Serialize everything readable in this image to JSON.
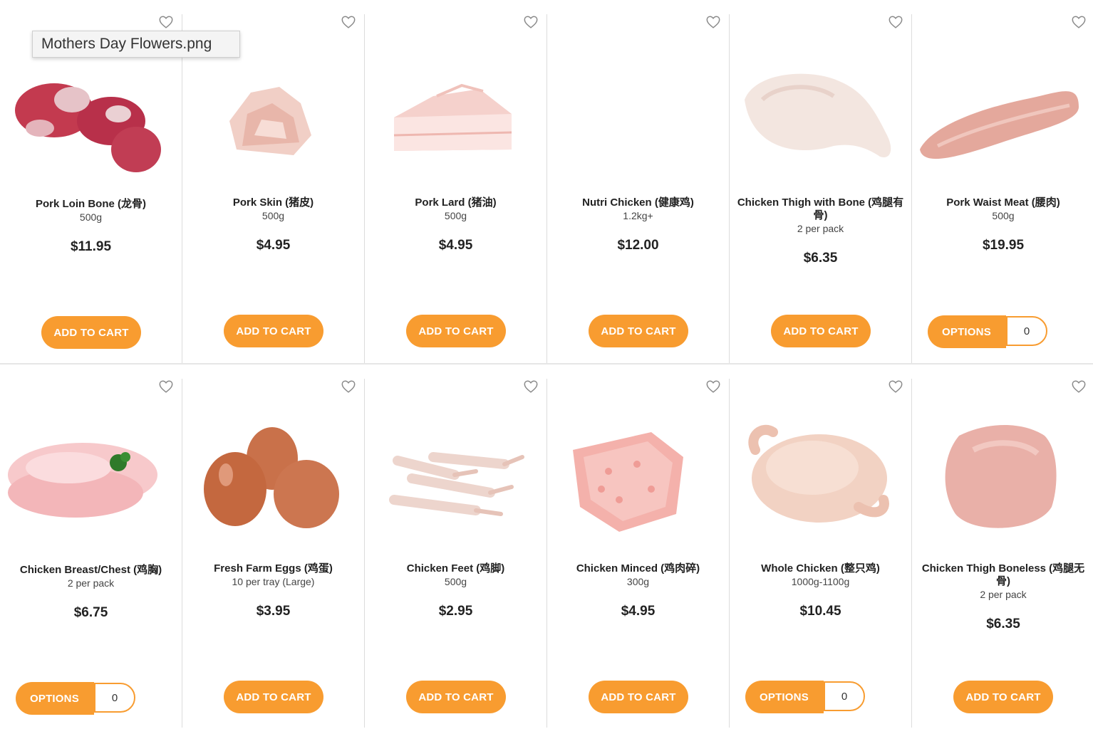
{
  "tooltip": "Mothers Day Flowers.png",
  "accent_color": "#f89c30",
  "products": [
    {
      "name": "Pork Loin Bone (龙骨)",
      "size": "500g",
      "price": "$11.95",
      "button": "ADD TO CART",
      "icon": "pork-bone"
    },
    {
      "name": "Pork Skin (猪皮)",
      "size": "500g",
      "price": "$4.95",
      "button": "ADD TO CART",
      "icon": "pork-skin"
    },
    {
      "name": "Pork Lard (猪油)",
      "size": "500g",
      "price": "$4.95",
      "button": "ADD TO CART",
      "icon": "pork-lard"
    },
    {
      "name": "Nutri Chicken (健康鸡)",
      "size": "1.2kg+",
      "price": "$12.00",
      "button": "ADD TO CART",
      "icon": "none"
    },
    {
      "name": "Chicken Thigh with Bone (鸡腿有骨)",
      "size": "2 per pack",
      "price": "$6.35",
      "button": "ADD TO CART",
      "icon": "chicken-thigh"
    },
    {
      "name": "Pork Waist Meat (腰肉)",
      "size": "500g",
      "price": "$19.95",
      "button": "OPTIONS",
      "qty": "0",
      "icon": "pork-loin"
    },
    {
      "name": "Chicken Breast/Chest (鸡胸)",
      "size": "2 per pack",
      "price": "$6.75",
      "button": "OPTIONS",
      "qty": "0",
      "icon": "chicken-breast"
    },
    {
      "name": "Fresh Farm Eggs (鸡蛋)",
      "size": "10 per tray (Large)",
      "price": "$3.95",
      "button": "ADD TO CART",
      "icon": "eggs"
    },
    {
      "name": "Chicken Feet (鸡脚)",
      "size": "500g",
      "price": "$2.95",
      "button": "ADD TO CART",
      "icon": "chicken-feet"
    },
    {
      "name": "Chicken Minced (鸡肉碎)",
      "size": "300g",
      "price": "$4.95",
      "button": "ADD TO CART",
      "icon": "minced"
    },
    {
      "name": "Whole Chicken (整只鸡)",
      "size": "1000g-1100g",
      "price": "$10.45",
      "button": "OPTIONS",
      "qty": "0",
      "icon": "whole-chicken"
    },
    {
      "name": "Chicken Thigh Boneless (鸡腿无骨)",
      "size": "2 per pack",
      "price": "$6.35",
      "button": "ADD TO CART",
      "icon": "thigh-boneless"
    }
  ]
}
